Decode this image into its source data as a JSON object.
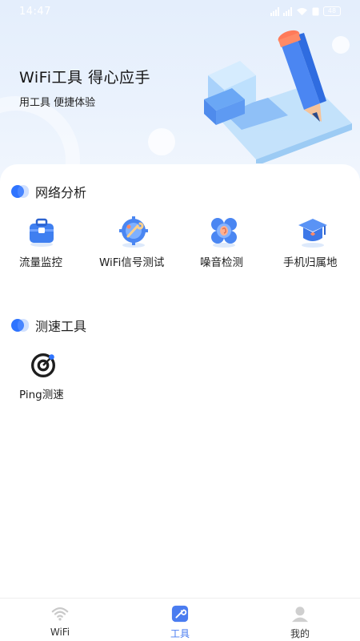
{
  "status_bar": {
    "time": "14:47",
    "battery": "48"
  },
  "hero": {
    "title": "WiFi工具 得心应手",
    "subtitle": "用工具 便捷体验"
  },
  "sections": [
    {
      "title": "网络分析",
      "tools": [
        {
          "label": "流量监控",
          "icon": "toolbox-icon"
        },
        {
          "label": "WiFi信号测试",
          "icon": "gear-wrench-icon"
        },
        {
          "label": "噪音检测",
          "icon": "ear-icon"
        },
        {
          "label": "手机归属地",
          "icon": "graduation-cap-icon"
        }
      ]
    },
    {
      "title": "测速工具",
      "tools": [
        {
          "label": "Ping测速",
          "icon": "target-icon"
        }
      ]
    }
  ],
  "bottom_nav": [
    {
      "label": "WiFi",
      "icon": "wifi-icon",
      "active": false
    },
    {
      "label": "工具",
      "icon": "tools-icon",
      "active": true
    },
    {
      "label": "我的",
      "icon": "profile-icon",
      "active": false
    }
  ],
  "colors": {
    "accent": "#2f74ff",
    "nav_active": "#4a7cf0",
    "hero_background": "#e4eefc"
  }
}
